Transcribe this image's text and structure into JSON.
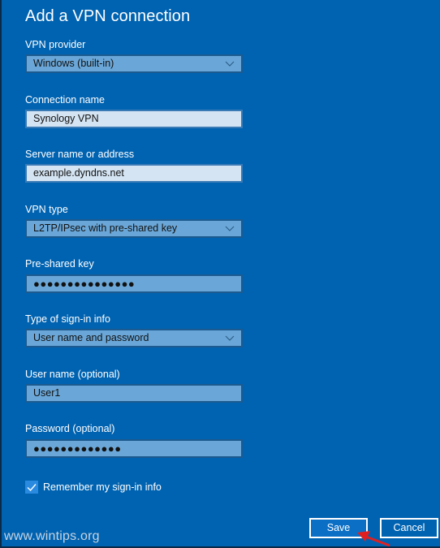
{
  "dialog": {
    "title": "Add a VPN connection"
  },
  "fields": {
    "vpn_provider": {
      "label": "VPN provider",
      "value": "Windows (built-in)",
      "type": "dropdown"
    },
    "connection_name": {
      "label": "Connection name",
      "value": "Synology VPN",
      "type": "text"
    },
    "server": {
      "label": "Server name or address",
      "value": "example.dyndns.net",
      "type": "text"
    },
    "vpn_type": {
      "label": "VPN type",
      "value": "L2TP/IPsec with pre-shared key",
      "type": "dropdown"
    },
    "pre_shared_key": {
      "label": "Pre-shared key",
      "value": "●●●●●●●●●●●●●●●",
      "type": "password"
    },
    "sign_in_type": {
      "label": "Type of sign-in info",
      "value": "User name and password",
      "type": "dropdown"
    },
    "username": {
      "label": "User name (optional)",
      "value": "User1",
      "type": "text"
    },
    "password": {
      "label": "Password (optional)",
      "value": "●●●●●●●●●●●●●",
      "type": "password"
    }
  },
  "remember": {
    "label": "Remember my sign-in info",
    "checked": true
  },
  "buttons": {
    "save": "Save",
    "cancel": "Cancel"
  },
  "watermark": "www.wintips.org",
  "colors": {
    "background": "#0063b1",
    "field": "#6aa7d8",
    "field_light": "#d4e4f3",
    "annotation_arrow": "#e02020"
  }
}
